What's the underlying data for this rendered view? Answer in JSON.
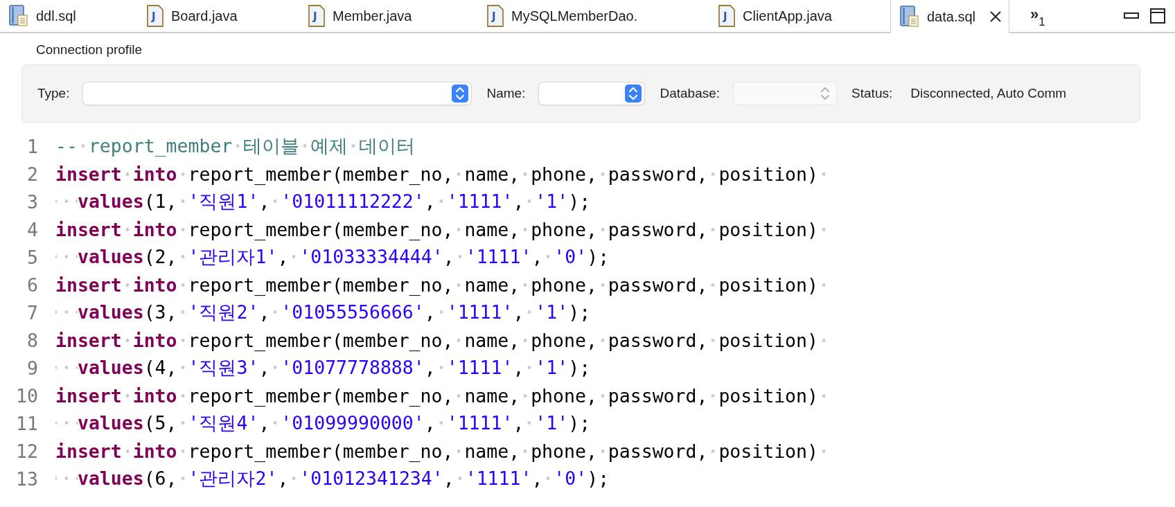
{
  "tabs": [
    {
      "label": "ddl.sql",
      "kind": "sql",
      "selected": false
    },
    {
      "label": "Board.java",
      "kind": "java",
      "icon_text": "J",
      "selected": false
    },
    {
      "label": "Member.java",
      "kind": "java",
      "icon_text": "J",
      "selected": false
    },
    {
      "label": "MySQLMemberDao.",
      "kind": "java",
      "icon_text": "J",
      "selected": false
    },
    {
      "label": "ClientApp.java",
      "kind": "java",
      "icon_text": "J",
      "selected": false
    },
    {
      "label": "data.sql",
      "kind": "sql",
      "selected": true
    }
  ],
  "overflow": {
    "chevron": "»",
    "count": "1"
  },
  "connection_profile": {
    "title": "Connection profile",
    "type": {
      "label": "Type:",
      "disabled": false
    },
    "name": {
      "label": "Name:",
      "disabled": false
    },
    "database": {
      "label": "Database:",
      "disabled": true
    },
    "status": {
      "label": "Status:",
      "value": "Disconnected, Auto Comm"
    }
  },
  "editor": {
    "lines": [
      {
        "number": "1",
        "tokens": [
          {
            "kind": "comment",
            "text": "-- report_member 테이블 예제 데이터"
          }
        ]
      },
      {
        "number": "2",
        "tokens": [
          {
            "kind": "keyword",
            "text": "insert into"
          },
          {
            "kind": "plain",
            "text": " report_member(member_no, name, phone, password, position) "
          }
        ]
      },
      {
        "number": "3",
        "tokens": [
          {
            "kind": "keyword",
            "text": "  values"
          },
          {
            "kind": "plain",
            "text": "(1, "
          },
          {
            "kind": "string",
            "text": "'직원1'"
          },
          {
            "kind": "plain",
            "text": ", "
          },
          {
            "kind": "string",
            "text": "'01011112222'"
          },
          {
            "kind": "plain",
            "text": ", "
          },
          {
            "kind": "string",
            "text": "'1111'"
          },
          {
            "kind": "plain",
            "text": ", "
          },
          {
            "kind": "string",
            "text": "'1'"
          },
          {
            "kind": "plain",
            "text": ");"
          }
        ]
      },
      {
        "number": "4",
        "tokens": [
          {
            "kind": "keyword",
            "text": "insert into"
          },
          {
            "kind": "plain",
            "text": " report_member(member_no, name, phone, password, position) "
          }
        ]
      },
      {
        "number": "5",
        "tokens": [
          {
            "kind": "keyword",
            "text": "  values"
          },
          {
            "kind": "plain",
            "text": "(2, "
          },
          {
            "kind": "string",
            "text": "'관리자1'"
          },
          {
            "kind": "plain",
            "text": ", "
          },
          {
            "kind": "string",
            "text": "'01033334444'"
          },
          {
            "kind": "plain",
            "text": ", "
          },
          {
            "kind": "string",
            "text": "'1111'"
          },
          {
            "kind": "plain",
            "text": ", "
          },
          {
            "kind": "string",
            "text": "'0'"
          },
          {
            "kind": "plain",
            "text": ");"
          }
        ]
      },
      {
        "number": "6",
        "tokens": [
          {
            "kind": "keyword",
            "text": "insert into"
          },
          {
            "kind": "plain",
            "text": " report_member(member_no, name, phone, password, position) "
          }
        ]
      },
      {
        "number": "7",
        "tokens": [
          {
            "kind": "keyword",
            "text": "  values"
          },
          {
            "kind": "plain",
            "text": "(3, "
          },
          {
            "kind": "string",
            "text": "'직원2'"
          },
          {
            "kind": "plain",
            "text": ", "
          },
          {
            "kind": "string",
            "text": "'01055556666'"
          },
          {
            "kind": "plain",
            "text": ", "
          },
          {
            "kind": "string",
            "text": "'1111'"
          },
          {
            "kind": "plain",
            "text": ", "
          },
          {
            "kind": "string",
            "text": "'1'"
          },
          {
            "kind": "plain",
            "text": ");"
          }
        ]
      },
      {
        "number": "8",
        "tokens": [
          {
            "kind": "keyword",
            "text": "insert into"
          },
          {
            "kind": "plain",
            "text": " report_member(member_no, name, phone, password, position) "
          }
        ]
      },
      {
        "number": "9",
        "tokens": [
          {
            "kind": "keyword",
            "text": "  values"
          },
          {
            "kind": "plain",
            "text": "(4, "
          },
          {
            "kind": "string",
            "text": "'직원3'"
          },
          {
            "kind": "plain",
            "text": ", "
          },
          {
            "kind": "string",
            "text": "'01077778888'"
          },
          {
            "kind": "plain",
            "text": ", "
          },
          {
            "kind": "string",
            "text": "'1111'"
          },
          {
            "kind": "plain",
            "text": ", "
          },
          {
            "kind": "string",
            "text": "'1'"
          },
          {
            "kind": "plain",
            "text": ");"
          }
        ]
      },
      {
        "number": "10",
        "tokens": [
          {
            "kind": "keyword",
            "text": "insert into"
          },
          {
            "kind": "plain",
            "text": " report_member(member_no, name, phone, password, position) "
          }
        ]
      },
      {
        "number": "11",
        "tokens": [
          {
            "kind": "keyword",
            "text": "  values"
          },
          {
            "kind": "plain",
            "text": "(5, "
          },
          {
            "kind": "string",
            "text": "'직원4'"
          },
          {
            "kind": "plain",
            "text": ", "
          },
          {
            "kind": "string",
            "text": "'01099990000'"
          },
          {
            "kind": "plain",
            "text": ", "
          },
          {
            "kind": "string",
            "text": "'1111'"
          },
          {
            "kind": "plain",
            "text": ", "
          },
          {
            "kind": "string",
            "text": "'1'"
          },
          {
            "kind": "plain",
            "text": ");"
          }
        ]
      },
      {
        "number": "12",
        "tokens": [
          {
            "kind": "keyword",
            "text": "insert into"
          },
          {
            "kind": "plain",
            "text": " report_member(member_no, name, phone, password, position) "
          }
        ]
      },
      {
        "number": "13",
        "tokens": [
          {
            "kind": "keyword",
            "text": "  values"
          },
          {
            "kind": "plain",
            "text": "(6, "
          },
          {
            "kind": "string",
            "text": "'관리자2'"
          },
          {
            "kind": "plain",
            "text": ", "
          },
          {
            "kind": "string",
            "text": "'01012341234'"
          },
          {
            "kind": "plain",
            "text": ", "
          },
          {
            "kind": "string",
            "text": "'1111'"
          },
          {
            "kind": "plain",
            "text": ", "
          },
          {
            "kind": "string",
            "text": "'0'"
          },
          {
            "kind": "plain",
            "text": ");"
          }
        ]
      }
    ]
  }
}
